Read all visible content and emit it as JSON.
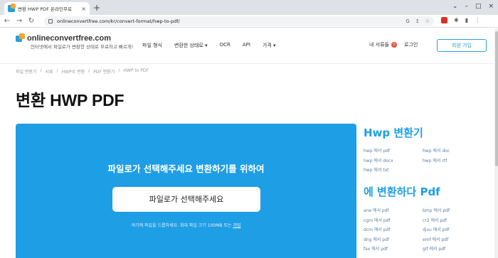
{
  "browser": {
    "tab_title": "변환 HWP PDF 온라인무료",
    "tab_close": "×",
    "new_tab": "+",
    "strip_controls": [
      "⌄",
      "–",
      "□",
      "×"
    ],
    "url": "onlineconvertfree.com/kr/convert-format/hwp-to-pdf/",
    "nav": [
      "←",
      "→",
      "↻"
    ],
    "omnibox_icons": [
      "G",
      "↥",
      "☆"
    ],
    "menu": "⋮"
  },
  "header": {
    "logo_text": "onlineconvertfree.com",
    "tagline": "인터넷에서 파일로가 변환한 상태로 무료하고 빠르게!",
    "nav": [
      "파일 형식",
      "변환한 상태로 ▾",
      "OCR",
      "API",
      "가격 ▾"
    ],
    "my_files": "내 서류들",
    "files_count": "0",
    "login": "로그인",
    "join": "회원 가입"
  },
  "breadcrumb": [
    "파일 변환기",
    "/",
    "서류",
    "/",
    "HWP로 변환",
    "/",
    "PDF 변환기",
    "/",
    "HWP to PDF"
  ],
  "page_title": "변환 HWP PDF",
  "upload": {
    "heading": "파일로가 선택해주세요 변환하기를 위하여",
    "button": "파일로가 선택해주세요",
    "note": "여기에 파일을 드롭하세요. 최대 파일 크기 100MB 또는",
    "note_link": "가입"
  },
  "sidebar": {
    "heading1": "Hwp 변환기",
    "links1": [
      "hwp 에서 pdf",
      "hwp 에서 doc",
      "hwp 에서 docx",
      "hwp 에서 rtf",
      "hwp 에서 txt"
    ],
    "heading2": "에 변환하다 Pdf",
    "links2": [
      "arw 에서 pdf",
      "bmp 에서 pdf",
      "cgm 에서 pdf",
      "cr2 에서 pdf",
      "dcm 에서 pdf",
      "djvu 에서 pdf",
      "dng 에서 pdf",
      "emf 에서 pdf",
      "fax 에서 pdf",
      "gif 에서 pdf"
    ]
  }
}
